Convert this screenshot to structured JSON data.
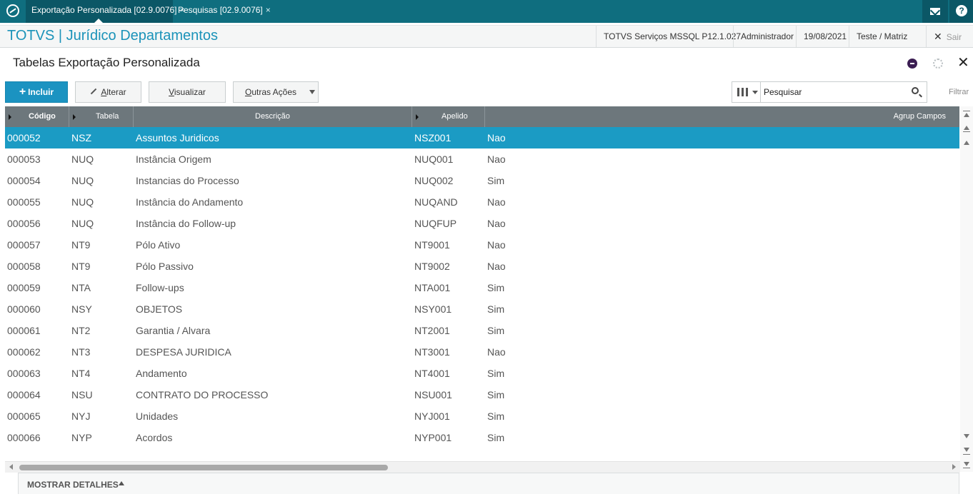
{
  "tabs": [
    {
      "label": "Exportação Personalizada [02.9.0076]",
      "close": "×"
    },
    {
      "label": "Pesquisas [02.9.0076]",
      "close": "×"
    }
  ],
  "header": {
    "app_title": "TOTVS | Jurídico Departamentos",
    "environment": "TOTVS Serviços MSSQL P12.1.027",
    "user": "Administrador",
    "date": "19/08/2021",
    "branch": "Teste / Matriz",
    "exit_label": "Sair"
  },
  "page": {
    "title": "Tabelas Exportação Personalizada"
  },
  "toolbar": {
    "include_label": "Incluir",
    "edit_label": "lterar",
    "edit_first": "A",
    "view_label": "isualizar",
    "view_first": "V",
    "other_label": "utras Ações",
    "other_first": "O"
  },
  "search": {
    "placeholder": "Pesquisar",
    "filter_label": "Filtrar"
  },
  "grid": {
    "columns": [
      "Código",
      "Tabela",
      "Descrição",
      "Apelido",
      "Agrup Campos"
    ],
    "rows": [
      [
        "000052",
        "NSZ",
        "Assuntos Juridicos",
        "NSZ001",
        "Nao"
      ],
      [
        "000053",
        "NUQ",
        "Instância Origem",
        "NUQ001",
        "Nao"
      ],
      [
        "000054",
        "NUQ",
        "Instancias do Processo",
        "NUQ002",
        "Sim"
      ],
      [
        "000055",
        "NUQ",
        "Instância do Andamento",
        "NUQAND",
        "Nao"
      ],
      [
        "000056",
        "NUQ",
        "Instância do Follow-up",
        "NUQFUP",
        "Nao"
      ],
      [
        "000057",
        "NT9",
        "Pólo Ativo",
        "NT9001",
        "Nao"
      ],
      [
        "000058",
        "NT9",
        "Pólo Passivo",
        "NT9002",
        "Nao"
      ],
      [
        "000059",
        "NTA",
        "Follow-ups",
        "NTA001",
        "Sim"
      ],
      [
        "000060",
        "NSY",
        "OBJETOS",
        "NSY001",
        "Sim"
      ],
      [
        "000061",
        "NT2",
        "Garantia / Alvara",
        "NT2001",
        "Sim"
      ],
      [
        "000062",
        "NT3",
        "DESPESA JURIDICA",
        "NT3001",
        "Nao"
      ],
      [
        "000063",
        "NT4",
        "Andamento",
        "NT4001",
        "Sim"
      ],
      [
        "000064",
        "NSU",
        "CONTRATO DO PROCESSO",
        "NSU001",
        "Sim"
      ],
      [
        "000065",
        "NYJ",
        "Unidades",
        "NYJ001",
        "Sim"
      ],
      [
        "000066",
        "NYP",
        "Acordos",
        "NYP001",
        "Sim"
      ]
    ],
    "selected_row": 0
  },
  "details": {
    "label": "MOSTRAR DETALHES"
  },
  "colors": {
    "topbar": "#0f6e7f",
    "accent": "#1b93c1",
    "selected_row": "#1b9bc4",
    "grid_header": "#6d777c"
  }
}
